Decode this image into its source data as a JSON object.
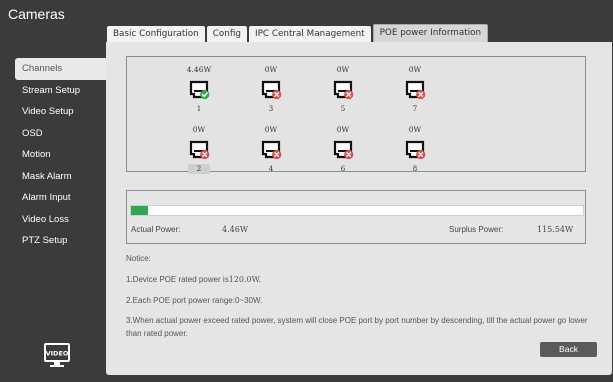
{
  "app": {
    "title": "Cameras"
  },
  "tabs": [
    {
      "label": "Basic Configuration",
      "active": false
    },
    {
      "label": "Config",
      "active": false
    },
    {
      "label": "IPC Central Management",
      "active": false
    },
    {
      "label": "POE power Information",
      "active": true
    }
  ],
  "sidebar": {
    "items": [
      {
        "label": "Channels",
        "active": true
      },
      {
        "label": "Stream Setup"
      },
      {
        "label": "Video Setup"
      },
      {
        "label": "OSD"
      },
      {
        "label": "Motion"
      },
      {
        "label": "Mask Alarm"
      },
      {
        "label": "Alarm Input"
      },
      {
        "label": "Video Loss"
      },
      {
        "label": "PTZ Setup"
      }
    ],
    "footer_icon_label": "VIDEO"
  },
  "ports": [
    {
      "number": "1",
      "power": "4.46W",
      "status": "connected"
    },
    {
      "number": "3",
      "power": "0W",
      "status": "disconnected"
    },
    {
      "number": "5",
      "power": "0W",
      "status": "disconnected"
    },
    {
      "number": "7",
      "power": "0W",
      "status": "disconnected"
    },
    {
      "number": "2",
      "power": "0W",
      "status": "disconnected",
      "selected": true
    },
    {
      "number": "4",
      "power": "0W",
      "status": "disconnected"
    },
    {
      "number": "6",
      "power": "0W",
      "status": "disconnected"
    },
    {
      "number": "8",
      "power": "0W",
      "status": "disconnected"
    }
  ],
  "power": {
    "actual_label": "Actual Power:",
    "actual_value": "4.46W",
    "surplus_label": "Surplus Power:",
    "surplus_value": "115.54W",
    "usage_fraction": 0.037
  },
  "notice": {
    "title": "Notice:",
    "line1_prefix": "1.Device POE rated power is",
    "line1_value": "120.0W.",
    "line2": "2.Each POE port power range:0~30W.",
    "line3": "3.When actual power exceed rated power, system will close POE port by port number by descending, till the actual power go lower than rated power."
  },
  "back_label": "Back",
  "colors": {
    "background": "#3b3b3b",
    "content": "#e5e5e5",
    "ok": "#2fa84f",
    "error": "#e24a4a",
    "button": "#5a5a5a"
  },
  "icons": {
    "port_icon": "ethernet-port-icon",
    "connected_badge": "check-icon",
    "disconnected_badge": "x-icon",
    "footer_icon": "video-logo-icon"
  }
}
